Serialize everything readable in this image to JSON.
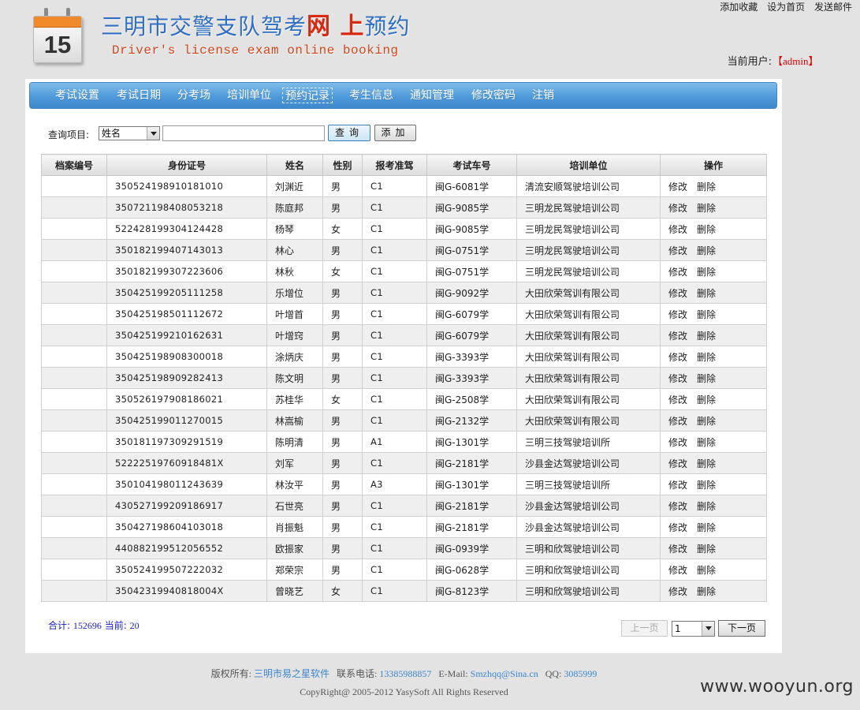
{
  "header": {
    "calendar_day": "15",
    "title_part1": "三明市交警支队驾考",
    "title_highlight": "网 上",
    "title_part2": "预约",
    "subtitle": "Driver's license exam online booking",
    "top_links": [
      "添加收藏",
      "设为首页",
      "发送邮件"
    ],
    "current_user_label": "当前用户:",
    "current_user": "admin"
  },
  "nav": {
    "items": [
      "考试设置",
      "考试日期",
      "分考场",
      "培训单位",
      "预约记录",
      "考生信息",
      "通知管理",
      "修改密码",
      "注销"
    ],
    "active": "预约记录"
  },
  "search": {
    "label": "查询项目:",
    "field_value": "姓名",
    "query_button": "查询",
    "add_button": "添加"
  },
  "table": {
    "headers": [
      "档案编号",
      "身份证号",
      "姓名",
      "性别",
      "报考准驾",
      "考试车号",
      "培训单位",
      "操作"
    ],
    "edit_label": "修改",
    "delete_label": "删除",
    "rows": [
      {
        "archive": "",
        "id": "350524198910181010",
        "name": "刘渊近",
        "gender": "男",
        "license": "C1",
        "car": "闽G-6081学",
        "school": "清流安顺驾驶培训公司"
      },
      {
        "archive": "",
        "id": "350721198408053218",
        "name": "陈庭邦",
        "gender": "男",
        "license": "C1",
        "car": "闽G-9085学",
        "school": "三明龙民驾驶培训公司"
      },
      {
        "archive": "",
        "id": "522428199304124428",
        "name": "杨琴",
        "gender": "女",
        "license": "C1",
        "car": "闽G-9085学",
        "school": "三明龙民驾驶培训公司"
      },
      {
        "archive": "",
        "id": "350182199407143013",
        "name": "林心",
        "gender": "男",
        "license": "C1",
        "car": "闽G-0751学",
        "school": "三明龙民驾驶培训公司"
      },
      {
        "archive": "",
        "id": "350182199307223606",
        "name": "林秋",
        "gender": "女",
        "license": "C1",
        "car": "闽G-0751学",
        "school": "三明龙民驾驶培训公司"
      },
      {
        "archive": "",
        "id": "350425199205111258",
        "name": "乐增位",
        "gender": "男",
        "license": "C1",
        "car": "闽G-9092学",
        "school": "大田欣荣驾训有限公司"
      },
      {
        "archive": "",
        "id": "350425198501112672",
        "name": "叶增首",
        "gender": "男",
        "license": "C1",
        "car": "闽G-6079学",
        "school": "大田欣荣驾训有限公司"
      },
      {
        "archive": "",
        "id": "350425199210162631",
        "name": "叶增窍",
        "gender": "男",
        "license": "C1",
        "car": "闽G-6079学",
        "school": "大田欣荣驾训有限公司"
      },
      {
        "archive": "",
        "id": "350425198908300018",
        "name": "涂炳庆",
        "gender": "男",
        "license": "C1",
        "car": "闽G-3393学",
        "school": "大田欣荣驾训有限公司"
      },
      {
        "archive": "",
        "id": "350425198909282413",
        "name": "陈文明",
        "gender": "男",
        "license": "C1",
        "car": "闽G-3393学",
        "school": "大田欣荣驾训有限公司"
      },
      {
        "archive": "",
        "id": "350526197908186021",
        "name": "苏桂华",
        "gender": "女",
        "license": "C1",
        "car": "闽G-2508学",
        "school": "大田欣荣驾训有限公司"
      },
      {
        "archive": "",
        "id": "350425199011270015",
        "name": "林嵩榆",
        "gender": "男",
        "license": "C1",
        "car": "闽G-2132学",
        "school": "大田欣荣驾训有限公司"
      },
      {
        "archive": "",
        "id": "350181197309291519",
        "name": "陈明清",
        "gender": "男",
        "license": "A1",
        "car": "闽G-1301学",
        "school": "三明三技驾驶培训所"
      },
      {
        "archive": "",
        "id": "52222519760918481X",
        "name": "刘军",
        "gender": "男",
        "license": "C1",
        "car": "闽G-2181学",
        "school": "沙县金达驾驶培训公司"
      },
      {
        "archive": "",
        "id": "350104198011243639",
        "name": "林汝平",
        "gender": "男",
        "license": "A3",
        "car": "闽G-1301学",
        "school": "三明三技驾驶培训所"
      },
      {
        "archive": "",
        "id": "430527199209186917",
        "name": "石世亮",
        "gender": "男",
        "license": "C1",
        "car": "闽G-2181学",
        "school": "沙县金达驾驶培训公司"
      },
      {
        "archive": "",
        "id": "350427198604103018",
        "name": "肖振魁",
        "gender": "男",
        "license": "C1",
        "car": "闽G-2181学",
        "school": "沙县金达驾驶培训公司"
      },
      {
        "archive": "",
        "id": "440882199512056552",
        "name": "欧振家",
        "gender": "男",
        "license": "C1",
        "car": "闽G-0939学",
        "school": "三明和欣驾驶培训公司"
      },
      {
        "archive": "",
        "id": "350524199507222032",
        "name": "郑荣宗",
        "gender": "男",
        "license": "C1",
        "car": "闽G-0628学",
        "school": "三明和欣驾驶培训公司"
      },
      {
        "archive": "",
        "id": "35042319940818004X",
        "name": "曾晓艺",
        "gender": "女",
        "license": "C1",
        "car": "闽G-8123学",
        "school": "三明和欣驾驶培训公司"
      }
    ]
  },
  "summary": {
    "total_label": "合计:",
    "total": "152696",
    "current_label": "当前:",
    "current": "20"
  },
  "pager": {
    "prev": "上一页",
    "page": "1",
    "next": "下一页"
  },
  "footer": {
    "copyright_label": "版权所有:",
    "company": "三明市易之星软件",
    "phone_label": "联系电话:",
    "phone": "13385988857",
    "email_label": "E-Mail:",
    "email": "Smzhqq@Sina.cn",
    "qq_label": "QQ:",
    "qq": "3085999",
    "copyright_line": "CopyRight@ 2005-2012   YasySoft All Rights Reserved"
  },
  "watermark": "www.wooyun.org",
  "colors": {
    "nav_blue": "#4f9adb",
    "title_blue": "#2f6ec0",
    "highlight_red": "#d62a10",
    "user_red": "#e00000",
    "link_blue": "#3d86cf"
  }
}
